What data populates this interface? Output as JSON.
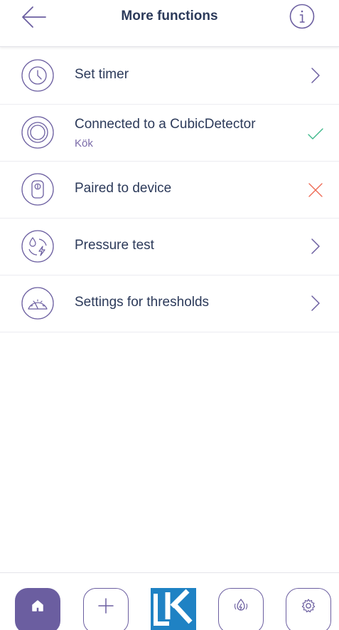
{
  "header": {
    "title": "More functions",
    "back_icon": "arrow-left-icon",
    "info_icon": "info-icon"
  },
  "menu": {
    "items": [
      {
        "label": "Set timer",
        "icon": "clock-icon",
        "right_icon": "chevron-right-icon"
      },
      {
        "label": "Connected to a CubicDetector",
        "sublabel": "Kök",
        "icon": "detector-ring-icon",
        "right_icon": "check-icon",
        "status": "connected"
      },
      {
        "label": "Paired to device",
        "icon": "paired-device-icon",
        "right_icon": "close-x-icon",
        "status": "not-paired"
      },
      {
        "label": "Pressure test",
        "icon": "pressure-test-icon",
        "right_icon": "chevron-right-icon"
      },
      {
        "label": "Settings for thresholds",
        "icon": "gauge-icon",
        "right_icon": "chevron-right-icon"
      }
    ]
  },
  "bottom_nav": {
    "items": [
      {
        "name": "home",
        "icon": "home-icon",
        "active": true
      },
      {
        "name": "add",
        "icon": "plus-icon",
        "active": false
      },
      {
        "name": "logo",
        "icon": "lk-logo",
        "active": false
      },
      {
        "name": "leak",
        "icon": "leak-drop-icon",
        "active": false
      },
      {
        "name": "settings",
        "icon": "gear-icon",
        "active": false
      }
    ]
  },
  "colors": {
    "primary": "#6b5ea0",
    "text": "#2c3a5a",
    "sublabel": "#7a6aa8",
    "success": "#3db88a",
    "error": "#ee6a55",
    "logo_blue": "#1f82c4"
  }
}
